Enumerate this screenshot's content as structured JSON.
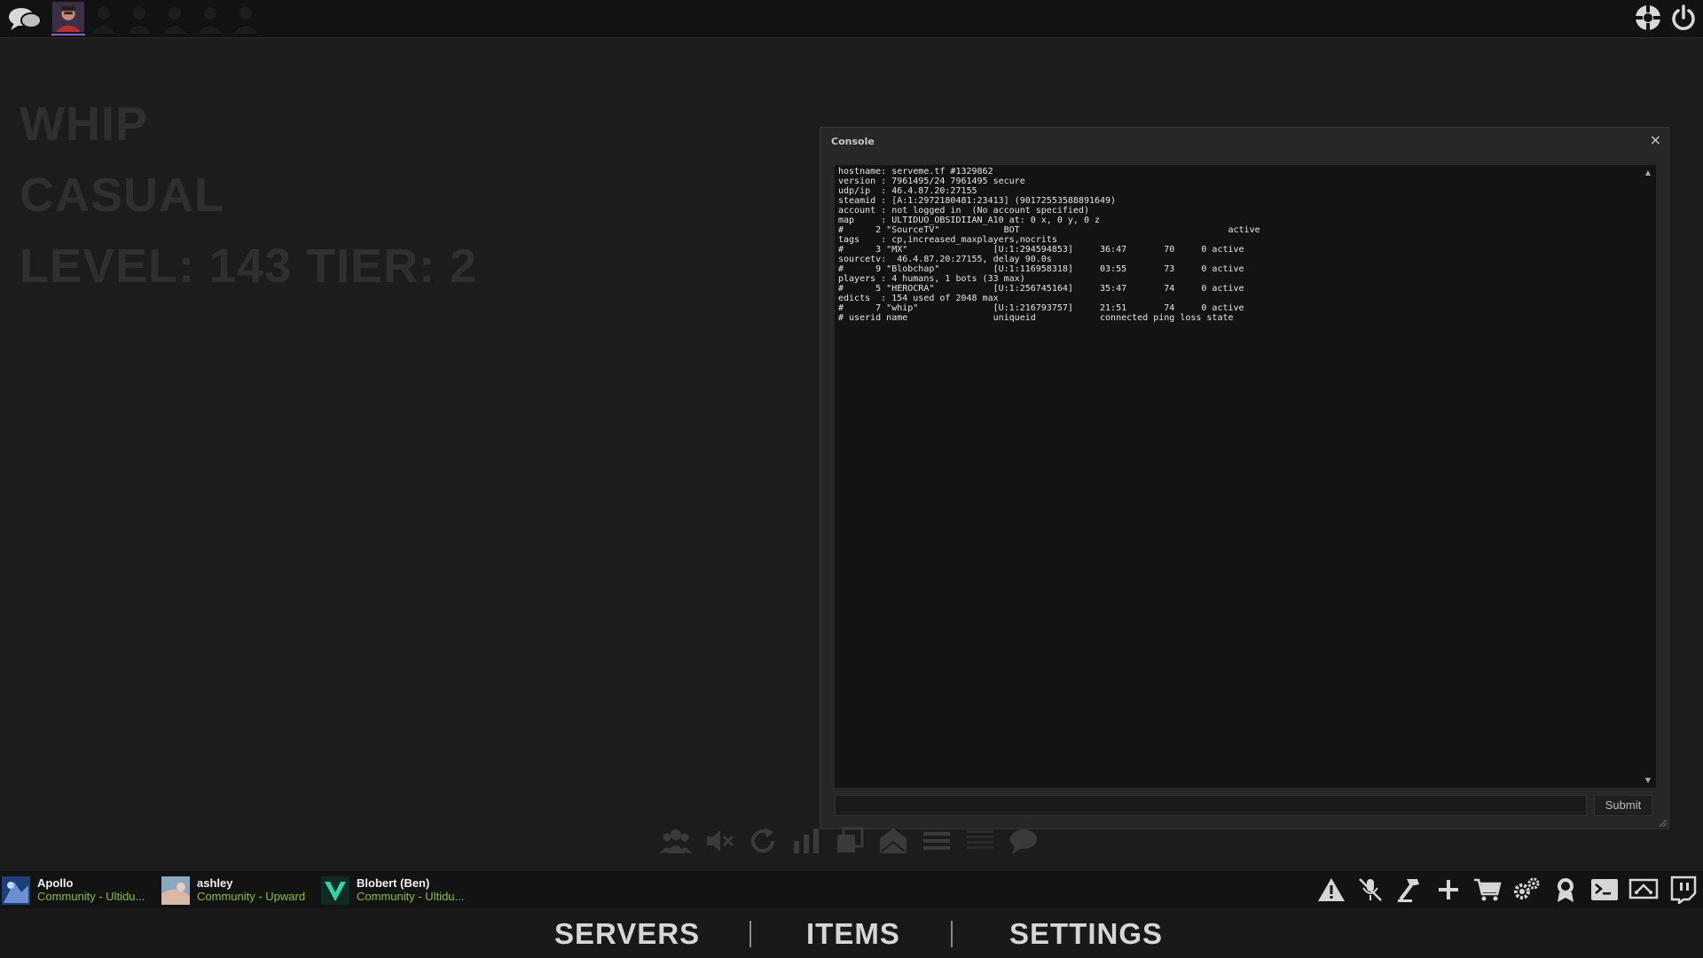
{
  "player": {
    "name": "WHIP",
    "mode": "CASUAL",
    "level_tier": "LEVEL: 143 TIER: 2"
  },
  "console": {
    "title": "Console",
    "close_label": "×",
    "output": "hostname: serveme.tf #1329862\nversion : 7961495/24 7961495 secure\nudp/ip  : 46.4.87.20:27155\nsteamid : [A:1:2972180481:23413] (90172553588891649)\naccount : not logged in  (No account specified)\nmap     : ULTIDUO_OBSIDIIAN_A10 at: 0 x, 0 y, 0 z\n#      2 \"SourceTV\"            BOT                                       active\ntags    : cp,increased_maxplayers,nocrits\n#      3 \"MX\"                [U:1:294594853]     36:47       70     0 active\nsourcetv:  46.4.87.20:27155, delay 90.0s\n#      9 \"Blobchap\"          [U:1:116958318]     03:55       73     0 active\nplayers : 4 humans, 1 bots (33 max)\n#      5 \"HEROCRA\"           [U:1:256745164]     35:47       74     0 active\nedicts  : 154 used of 2048 max\n#      7 \"whip\"              [U:1:216793757]     21:51       74     0 active\n# userid name                uniqueid            connected ping loss state",
    "input_value": "",
    "submit_label": "Submit"
  },
  "friends": [
    {
      "name": "Apollo",
      "status": "Community - Ultidu..."
    },
    {
      "name": "ashley",
      "status": "Community - Upward"
    },
    {
      "name": "Blobert (Ben)",
      "status": "Community - Ultidu..."
    }
  ],
  "nav": {
    "tabs": [
      {
        "label": "SERVERS"
      },
      {
        "label": "ITEMS"
      },
      {
        "label": "SETTINGS"
      }
    ]
  },
  "icons": {
    "top_left": [
      "chat-bubbles-icon"
    ],
    "top_right": [
      "tf2-logo-icon",
      "power-icon"
    ],
    "mid_toolbar": [
      "party-icon",
      "mute-icon",
      "reload-icon",
      "stats-icon",
      "windows-icon",
      "mail-icon",
      "menu-icon",
      "list-icon",
      "chat-icon"
    ],
    "bottom_right": [
      "warning-icon",
      "mic-muted-icon",
      "hammer-icon",
      "plus-icon",
      "cart-icon",
      "gears-icon",
      "badge-icon",
      "terminal-icon",
      "screen-share-icon",
      "twitch-icon"
    ]
  },
  "colors": {
    "accent": "#8a5fd6",
    "friend_status": "#8dbd39",
    "background": "#1c1c1c"
  }
}
